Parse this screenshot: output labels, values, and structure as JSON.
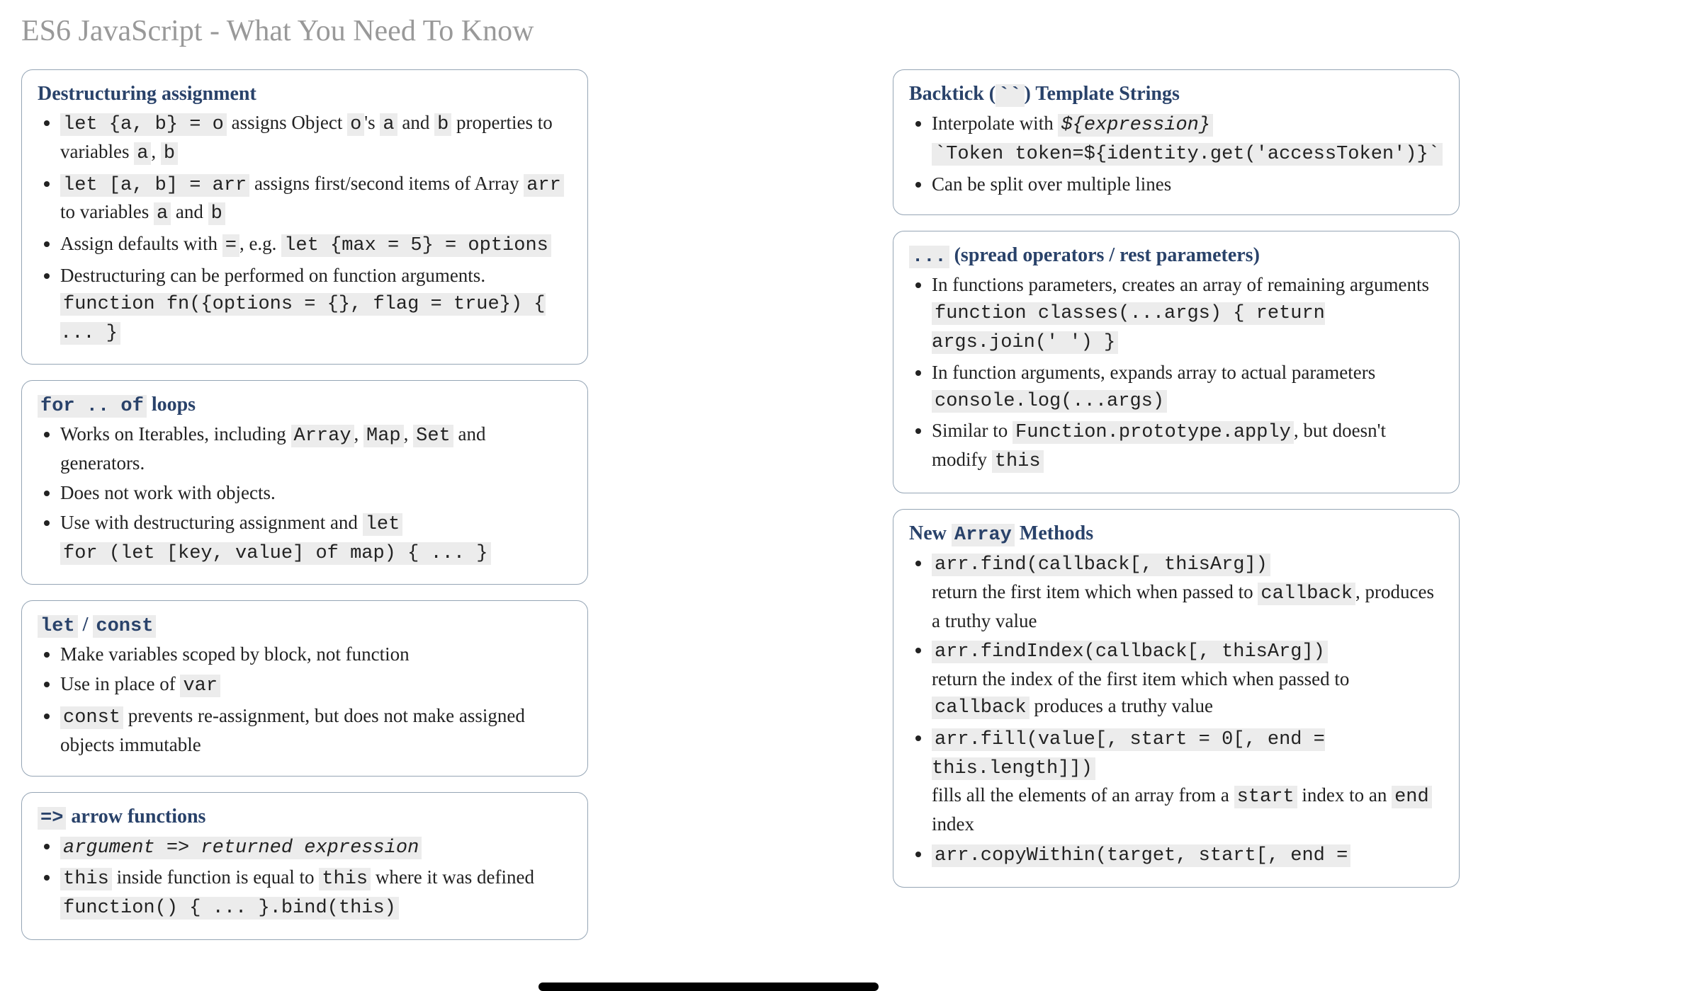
{
  "title": "ES6 JavaScript - What You Need To Know",
  "left": {
    "card1": {
      "heading": "Destructuring assignment",
      "i0_code1": "let {a, b} = o",
      "i0_t1": " assigns Object ",
      "i0_code2": "o",
      "i0_t2": "'s ",
      "i0_code3": "a",
      "i0_t3": " and ",
      "i0_code4": "b",
      "i0_t4": " properties to variables ",
      "i0_code5": "a",
      "i0_t5": ", ",
      "i0_code6": "b",
      "i1_code1": "let [a, b] = arr",
      "i1_t1": " assigns first/second items of Array ",
      "i1_code2": "arr",
      "i1_t2": " to variables ",
      "i1_code3": "a",
      "i1_t3": " and ",
      "i1_code4": "b",
      "i2_t1": "Assign defaults with ",
      "i2_code1": "=",
      "i2_t2": ", e.g. ",
      "i2_code2": "let {max = 5} = options",
      "i3_t1": "Destructuring can be performed on function arguments. ",
      "i3_code1": "function fn({options = {}, flag = true}) { ... }"
    },
    "card2": {
      "heading_code": "for .. of",
      "heading_text": " loops",
      "i0_t1": "Works on Iterables, including ",
      "i0_c1": "Array",
      "i0_t2": ", ",
      "i0_c2": "Map",
      "i0_t3": ", ",
      "i0_c3": "Set",
      "i0_t4": " and generators.",
      "i1": "Does not work with objects.",
      "i2_t1": "Use with destructuring assignment and ",
      "i2_c1": "let",
      "i2_c2": "for (let [key, value] of map) { ... }"
    },
    "card3": {
      "heading_c1": "let",
      "heading_sep": " / ",
      "heading_c2": "const",
      "i0": "Make variables scoped by block, not function",
      "i1_t1": "Use in place of ",
      "i1_c1": "var",
      "i2_c1": "const",
      "i2_t1": " prevents re-assignment, but does not make assigned objects immutable"
    },
    "card4": {
      "heading_c1": "=>",
      "heading_t1": " arrow functions",
      "i0_c1": "argument => returned expression",
      "i1_c1": "this",
      "i1_t1": " inside function is equal to ",
      "i1_c2": "this",
      "i1_t2": " where it was defined ",
      "i1_c3": "function() { ... }.bind(this)"
    }
  },
  "right": {
    "card1": {
      "heading_t1": "Backtick (",
      "heading_c1": "``",
      "heading_t2": ") Template Strings",
      "i0_t1": "Interpolate with ",
      "i0_c1": "${expression}",
      "i0_c2": "`Token token=${identity.get('accessToken')}`",
      "i1": "Can be split over multiple lines"
    },
    "card2": {
      "heading_c1": "...",
      "heading_t1": " (spread operators / rest parameters)",
      "i0_t1": "In functions parameters, creates an array of remaining arguments",
      "i0_c1": "function classes(...args) { return args.join(' ') }",
      "i1_t1": "In function arguments, expands array to actual parameters ",
      "i1_c1": "console.log(...args)",
      "i2_t1": "Similar to ",
      "i2_c1": "Function.prototype.apply",
      "i2_t2": ", but doesn't modify ",
      "i2_c2": "this"
    },
    "card3": {
      "heading_t1": "New ",
      "heading_c1": "Array",
      "heading_t2": " Methods",
      "i0_c1": "arr.find(callback[, thisArg])",
      "i0_t1": "return the first item which when passed to ",
      "i0_c2": "callback",
      "i0_t2": ", produces a truthy value",
      "i1_c1": "arr.findIndex(callback[, thisArg])",
      "i1_t1": "return the index of the first item which when passed to ",
      "i1_c2": "callback",
      "i1_t2": " produces a truthy value",
      "i2_c1": "arr.fill(value[, start = 0[, end = this.length]])",
      "i2_t1": "fills all the elements of an array from a ",
      "i2_c2": "start",
      "i2_t2": " index to an ",
      "i2_c3": "end",
      "i2_t3": " index",
      "i3_c1": "arr.copyWithin(target, start[, end ="
    }
  }
}
